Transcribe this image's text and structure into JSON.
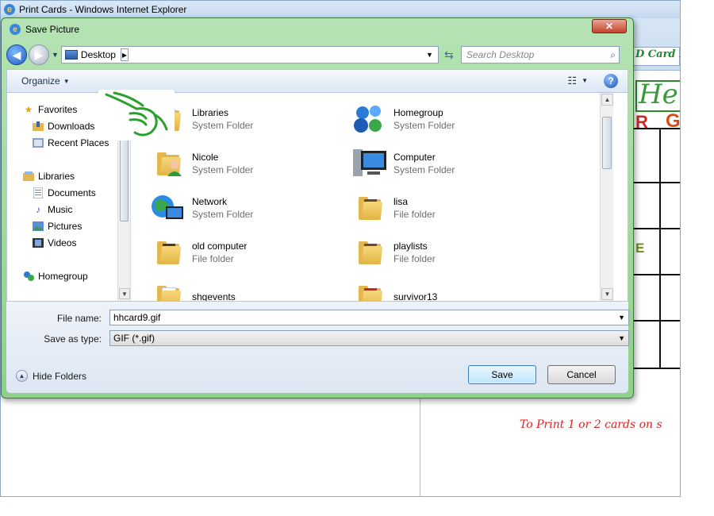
{
  "ie": {
    "title": "Print Cards - Windows Internet Explorer",
    "page_title_fragment": "D Card H",
    "hh_fragment": "He",
    "letter_r": "R",
    "letter_g": "G",
    "letter_e": "E",
    "print_note_fragment": "To Print 1 or 2 cards on s"
  },
  "dialog": {
    "title": "Save Picture",
    "close_label": "✕",
    "address": {
      "location": "Desktop",
      "search_placeholder": "Search Desktop"
    },
    "toolbar": {
      "organize_label": "Organize",
      "help_label": "?"
    },
    "nav": {
      "favorites_label": "Favorites",
      "downloads_label": "Downloads",
      "recent_places_label": "Recent Places",
      "libraries_label": "Libraries",
      "documents_label": "Documents",
      "music_label": "Music",
      "pictures_label": "Pictures",
      "videos_label": "Videos",
      "homegroup_label": "Homegroup"
    },
    "files": [
      {
        "name": "Libraries",
        "type": "System Folder",
        "icon": "libraries-icon"
      },
      {
        "name": "Homegroup",
        "type": "System Folder",
        "icon": "homegroup-icon"
      },
      {
        "name": "Nicole",
        "type": "System Folder",
        "icon": "user-folder-icon"
      },
      {
        "name": "Computer",
        "type": "System Folder",
        "icon": "computer-icon"
      },
      {
        "name": "Network",
        "type": "System Folder",
        "icon": "network-icon"
      },
      {
        "name": "lisa",
        "type": "File folder",
        "icon": "folder-icon"
      },
      {
        "name": "old computer",
        "type": "File folder",
        "icon": "folder-icon"
      },
      {
        "name": "playlists",
        "type": "File folder",
        "icon": "folder-icon"
      },
      {
        "name": "shgevents",
        "type": "",
        "icon": "folder-icon"
      },
      {
        "name": "survivor13",
        "type": "",
        "icon": "folder-icon"
      }
    ],
    "file_name_label": "File name:",
    "file_name_value": "hhcard9.gif",
    "save_as_type_label": "Save as type:",
    "save_as_type_value": "GIF (*.gif)",
    "hide_folders_label": "Hide Folders",
    "save_label": "Save",
    "cancel_label": "Cancel"
  },
  "colors": {
    "dialog_frame": "#8fd08c",
    "accent_green": "#1d8a2e",
    "accent_red": "#dd2222"
  }
}
